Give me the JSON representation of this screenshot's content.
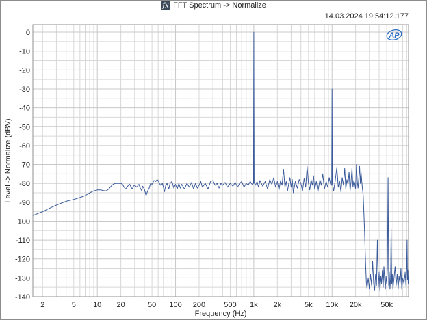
{
  "header": {
    "title_icon": "fx-icon",
    "title": "FFT Spectrum -> Normalize",
    "timestamp": "14.03.2024 19:54:12.177",
    "logo_text": "AP"
  },
  "colors": {
    "trace": "#3a5a9a",
    "grid": "#d8d8d8",
    "grid_major": "#c8c8c8",
    "logo": "#2b6cc4"
  },
  "chart_data": {
    "type": "line",
    "title": "FFT Spectrum -> Normalize",
    "xlabel": "Frequency (Hz)",
    "ylabel": "Level -> Normalize (dBV)",
    "x_scale": "log",
    "xlim": [
      1.5,
      95000
    ],
    "ylim": [
      -140,
      4
    ],
    "grid": true,
    "x_ticks": [
      {
        "value": 2,
        "label": "2"
      },
      {
        "value": 5,
        "label": "5"
      },
      {
        "value": 10,
        "label": "10"
      },
      {
        "value": 20,
        "label": "20"
      },
      {
        "value": 50,
        "label": "50"
      },
      {
        "value": 100,
        "label": "100"
      },
      {
        "value": 200,
        "label": "200"
      },
      {
        "value": 500,
        "label": "500"
      },
      {
        "value": 1000,
        "label": "1k"
      },
      {
        "value": 2000,
        "label": "2k"
      },
      {
        "value": 5000,
        "label": "5k"
      },
      {
        "value": 10000,
        "label": "10k"
      },
      {
        "value": 20000,
        "label": "20k"
      },
      {
        "value": 50000,
        "label": "50k"
      }
    ],
    "y_ticks": [
      {
        "value": 0,
        "label": "0"
      },
      {
        "value": -10,
        "label": "-10"
      },
      {
        "value": -20,
        "label": "-20"
      },
      {
        "value": -30,
        "label": "-30"
      },
      {
        "value": -40,
        "label": "-40"
      },
      {
        "value": -50,
        "label": "-50"
      },
      {
        "value": -60,
        "label": "-60"
      },
      {
        "value": -70,
        "label": "-70"
      },
      {
        "value": -80,
        "label": "-80"
      },
      {
        "value": -90,
        "label": "-90"
      },
      {
        "value": -100,
        "label": "-100"
      },
      {
        "value": -110,
        "label": "-110"
      },
      {
        "value": -120,
        "label": "-120"
      },
      {
        "value": -130,
        "label": "-130"
      },
      {
        "value": -140,
        "label": "-140"
      }
    ],
    "series": [
      {
        "points": [
          [
            1.5,
            -97
          ],
          [
            2,
            -95
          ],
          [
            2.5,
            -93
          ],
          [
            3,
            -91.5
          ],
          [
            4,
            -89.5
          ],
          [
            5,
            -88.5
          ],
          [
            6,
            -87.5
          ],
          [
            7,
            -86.5
          ],
          [
            8,
            -85
          ],
          [
            9,
            -84
          ],
          [
            10,
            -83.5
          ],
          [
            11,
            -83.5
          ],
          [
            12,
            -83.8
          ],
          [
            13,
            -84
          ],
          [
            14,
            -83
          ],
          [
            15,
            -81.5
          ],
          [
            16,
            -80.5
          ],
          [
            17,
            -80
          ],
          [
            18,
            -80
          ],
          [
            19,
            -80
          ],
          [
            20,
            -80
          ],
          [
            21,
            -80.5
          ],
          [
            22,
            -82
          ],
          [
            23,
            -83
          ],
          [
            24,
            -82
          ],
          [
            25,
            -81
          ],
          [
            26,
            -80.5
          ],
          [
            27,
            -82
          ],
          [
            28,
            -83
          ],
          [
            29,
            -81.5
          ],
          [
            30,
            -81
          ],
          [
            32,
            -82
          ],
          [
            34,
            -80.5
          ],
          [
            35,
            -82
          ],
          [
            37,
            -84
          ],
          [
            38,
            -81.5
          ],
          [
            40,
            -83
          ],
          [
            42,
            -86.5
          ],
          [
            44,
            -84
          ],
          [
            46,
            -82.5
          ],
          [
            48,
            -80
          ],
          [
            50,
            -80.5
          ],
          [
            53,
            -78.5
          ],
          [
            56,
            -79
          ],
          [
            58,
            -78
          ],
          [
            60,
            -78.5
          ],
          [
            62,
            -80
          ],
          [
            65,
            -81
          ],
          [
            68,
            -80
          ],
          [
            70,
            -82
          ],
          [
            72,
            -84.5
          ],
          [
            75,
            -81
          ],
          [
            78,
            -80
          ],
          [
            82,
            -83
          ],
          [
            85,
            -80
          ],
          [
            90,
            -79
          ],
          [
            95,
            -82.5
          ],
          [
            100,
            -80.5
          ],
          [
            105,
            -83
          ],
          [
            110,
            -80
          ],
          [
            115,
            -82.5
          ],
          [
            120,
            -80.5
          ],
          [
            130,
            -83
          ],
          [
            140,
            -80
          ],
          [
            150,
            -82
          ],
          [
            160,
            -79.5
          ],
          [
            170,
            -83
          ],
          [
            180,
            -80
          ],
          [
            190,
            -82.5
          ],
          [
            200,
            -81
          ],
          [
            210,
            -79
          ],
          [
            220,
            -82
          ],
          [
            240,
            -80
          ],
          [
            260,
            -83
          ],
          [
            280,
            -79
          ],
          [
            300,
            -78.5
          ],
          [
            320,
            -81
          ],
          [
            340,
            -80
          ],
          [
            360,
            -82.5
          ],
          [
            380,
            -80
          ],
          [
            400,
            -81
          ],
          [
            430,
            -79.5
          ],
          [
            460,
            -82
          ],
          [
            500,
            -80
          ],
          [
            540,
            -81.5
          ],
          [
            580,
            -79.5
          ],
          [
            620,
            -82
          ],
          [
            660,
            -80
          ],
          [
            700,
            -79
          ],
          [
            750,
            -82
          ],
          [
            800,
            -80
          ],
          [
            850,
            -81
          ],
          [
            900,
            -79
          ],
          [
            950,
            -80.5
          ],
          [
            990,
            -80
          ],
          [
            1000,
            0
          ],
          [
            1010,
            -79.5
          ],
          [
            1050,
            -81
          ],
          [
            1100,
            -79
          ],
          [
            1150,
            -82
          ],
          [
            1200,
            -78.5
          ],
          [
            1300,
            -81.5
          ],
          [
            1400,
            -79
          ],
          [
            1500,
            -83
          ],
          [
            1600,
            -78
          ],
          [
            1700,
            -80.5
          ],
          [
            1800,
            -77
          ],
          [
            1900,
            -82
          ],
          [
            2000,
            -79
          ],
          [
            2100,
            -83.5
          ],
          [
            2200,
            -78.5
          ],
          [
            2300,
            -81
          ],
          [
            2400,
            -72.5
          ],
          [
            2500,
            -82
          ],
          [
            2600,
            -79
          ],
          [
            2700,
            -84
          ],
          [
            2800,
            -80
          ],
          [
            2900,
            -77
          ],
          [
            3000,
            -82
          ],
          [
            3100,
            -78
          ],
          [
            3200,
            -85
          ],
          [
            3400,
            -79
          ],
          [
            3600,
            -82.5
          ],
          [
            3800,
            -78
          ],
          [
            4000,
            -80
          ],
          [
            4200,
            -84
          ],
          [
            4400,
            -77.5
          ],
          [
            4600,
            -82
          ],
          [
            4800,
            -71
          ],
          [
            5000,
            -80
          ],
          [
            5200,
            -83.5
          ],
          [
            5400,
            -78
          ],
          [
            5600,
            -81
          ],
          [
            5800,
            -76
          ],
          [
            6000,
            -83
          ],
          [
            6300,
            -79
          ],
          [
            6600,
            -84.5
          ],
          [
            7000,
            -78
          ],
          [
            7300,
            -81
          ],
          [
            7600,
            -75
          ],
          [
            8000,
            -83
          ],
          [
            8400,
            -79
          ],
          [
            8800,
            -82
          ],
          [
            9200,
            -77
          ],
          [
            9600,
            -80.5
          ],
          [
            9900,
            -81
          ],
          [
            10000,
            -30
          ],
          [
            10100,
            -80
          ],
          [
            10500,
            -84
          ],
          [
            11000,
            -78.5
          ],
          [
            11500,
            -71.5
          ],
          [
            12000,
            -82
          ],
          [
            12500,
            -79
          ],
          [
            13000,
            -84.5
          ],
          [
            13500,
            -77
          ],
          [
            14000,
            -81
          ],
          [
            14500,
            -72
          ],
          [
            15000,
            -83
          ],
          [
            15500,
            -78
          ],
          [
            16000,
            -80.5
          ],
          [
            16500,
            -74
          ],
          [
            17000,
            -84
          ],
          [
            17500,
            -79
          ],
          [
            18000,
            -72
          ],
          [
            18500,
            -82
          ],
          [
            19000,
            -78.5
          ],
          [
            19500,
            -80
          ],
          [
            20000,
            -83
          ],
          [
            20500,
            -70
          ],
          [
            21000,
            -79
          ],
          [
            21500,
            -82.5
          ],
          [
            22000,
            -77
          ],
          [
            22500,
            -71
          ],
          [
            23000,
            -80
          ],
          [
            23500,
            -74
          ],
          [
            24000,
            -79
          ],
          [
            24500,
            -83
          ],
          [
            25000,
            -86
          ],
          [
            25500,
            -95
          ],
          [
            26000,
            -105
          ],
          [
            26500,
            -115
          ],
          [
            27000,
            -125
          ],
          [
            27500,
            -133
          ],
          [
            28000,
            -135.5
          ],
          [
            29000,
            -130
          ],
          [
            30000,
            -136
          ],
          [
            31000,
            -128
          ],
          [
            32000,
            -134
          ],
          [
            33000,
            -121
          ],
          [
            34000,
            -133
          ],
          [
            35000,
            -136.5
          ],
          [
            36000,
            -128
          ],
          [
            37000,
            -134
          ],
          [
            38000,
            -110
          ],
          [
            39000,
            -135
          ],
          [
            40000,
            -127
          ],
          [
            41000,
            -137
          ],
          [
            42000,
            -129
          ],
          [
            43000,
            -133
          ],
          [
            44000,
            -126
          ],
          [
            45000,
            -135
          ],
          [
            46000,
            -124
          ],
          [
            47000,
            -131
          ],
          [
            48000,
            -136
          ],
          [
            49000,
            -129
          ],
          [
            50000,
            -133
          ],
          [
            51000,
            -125
          ],
          [
            52000,
            -77
          ],
          [
            53000,
            -134
          ],
          [
            54000,
            -127
          ],
          [
            55000,
            -136
          ],
          [
            56000,
            -130
          ],
          [
            57000,
            -104
          ],
          [
            58000,
            -133
          ],
          [
            59000,
            -128
          ],
          [
            60000,
            -136
          ],
          [
            62000,
            -130
          ],
          [
            64000,
            -124
          ],
          [
            66000,
            -134
          ],
          [
            68000,
            -128
          ],
          [
            70000,
            -136
          ],
          [
            72000,
            -129
          ],
          [
            74000,
            -133
          ],
          [
            76000,
            -125
          ],
          [
            78000,
            -136
          ],
          [
            80000,
            -130
          ],
          [
            83000,
            -133
          ],
          [
            86000,
            -127
          ],
          [
            88000,
            -134
          ],
          [
            90000,
            -124
          ],
          [
            91000,
            -110
          ],
          [
            92000,
            -131
          ],
          [
            93000,
            -126
          ],
          [
            94000,
            -133
          ],
          [
            95000,
            -129
          ]
        ]
      }
    ]
  }
}
